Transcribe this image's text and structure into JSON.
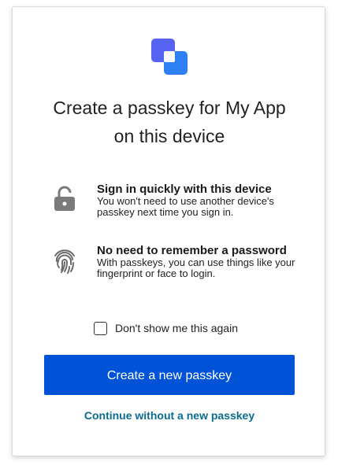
{
  "dialog": {
    "title_line1": "Create a passkey for My App",
    "title_line2": "on this device"
  },
  "features": [
    {
      "icon": "lock-open-icon",
      "title": "Sign in quickly with this device",
      "description": "You won't need to use another device's passkey next time you sign in."
    },
    {
      "icon": "fingerprint-icon",
      "title": "No need to remember a password",
      "description": "With passkeys, you can use things like your fingerprint or face to login."
    }
  ],
  "checkbox": {
    "label": "Don't show me this again",
    "checked": false
  },
  "actions": {
    "primary_label": "Create a new passkey",
    "secondary_label": "Continue without a new passkey"
  },
  "colors": {
    "primary_button": "#0053d6",
    "link": "#0b6c8f",
    "logo_back": "#4f6df5",
    "logo_front": "#2f7ff5",
    "icon_gray": "#7a7a7a"
  }
}
